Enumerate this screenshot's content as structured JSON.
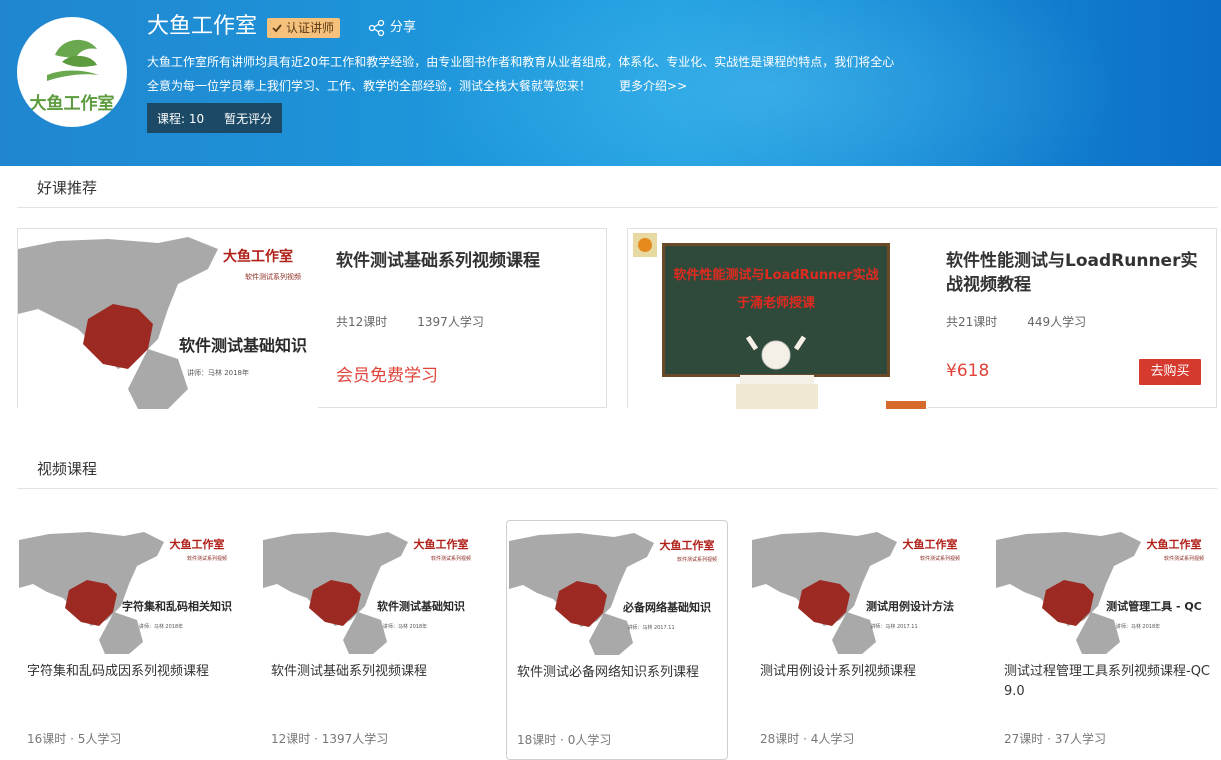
{
  "header": {
    "logo_text": "大鱼工作室",
    "title": "大鱼工作室",
    "badge": "认证讲师",
    "share": "分享",
    "desc_line1": "大鱼工作室所有讲师均具有近20年工作和教学经验，由专业图书作者和教育从业者组成，体系化、专业化、实战性是课程的特点，我们将全心",
    "desc_line2": "全意为每一位学员奉上我们学习、工作、教学的全部经验，测试全栈大餐就等您来！",
    "more": "更多介绍>>",
    "courses": "课程: 10",
    "rating": "暂无评分"
  },
  "sections": {
    "featured": "好课推荐",
    "videos": "视频课程"
  },
  "featured": [
    {
      "title": "软件测试基础系列视频课程",
      "lessons": "共12课时",
      "students": "1397人学习",
      "price": "会员免费学习",
      "thumb_brand": "大鱼工作室",
      "thumb_sub": "软件测试系列视频",
      "thumb_title": "软件测试基础知识",
      "thumb_author": "讲师：马林 2018年"
    },
    {
      "title": "软件性能测试与LoadRunner实战视频教程",
      "lessons": "共21课时",
      "students": "449人学习",
      "price": "¥618",
      "buy": "去购买",
      "thumb_line1": "软件性能测试与LoadRunner实战",
      "thumb_line2": "于涌老师授课"
    }
  ],
  "videos": [
    {
      "title": "字符集和乱码成因系列视频课程",
      "meta": "16课时 · 5人学习",
      "thumb_title": "字符集和乱码相关知识",
      "thumb_author": "讲师：马林 2018年"
    },
    {
      "title": "软件测试基础系列视频课程",
      "meta": "12课时 · 1397人学习",
      "thumb_title": "软件测试基础知识",
      "thumb_author": "讲师：马林 2018年"
    },
    {
      "title": "软件测试必备网络知识系列课程",
      "meta": "18课时 · 0人学习",
      "thumb_title": "必备网络基础知识",
      "thumb_author": "讲师：马林 2017.11"
    },
    {
      "title": "测试用例设计系列视频课程",
      "meta": "28课时 · 4人学习",
      "thumb_title": "测试用例设计方法",
      "thumb_author": "讲师：马林 2017.11"
    },
    {
      "title": "测试过程管理工具系列视频课程-QC 9.0",
      "meta": "27课时 · 37人学习",
      "thumb_title": "测试管理工具 - QC",
      "thumb_author": "讲师：马林 2018年"
    }
  ],
  "thumb_brand": "大鱼工作室",
  "thumb_sub": "软件测试系列视频",
  "colors": {
    "header": "#1e9ee0",
    "price": "#e0433a",
    "buy": "#d63a2f",
    "badge": "#f5c17c",
    "map_china": "#9c2a22",
    "map_gray": "#a9a9a9"
  },
  "icons": [
    "check-icon",
    "share-icon",
    "fish-logo-icon"
  ]
}
